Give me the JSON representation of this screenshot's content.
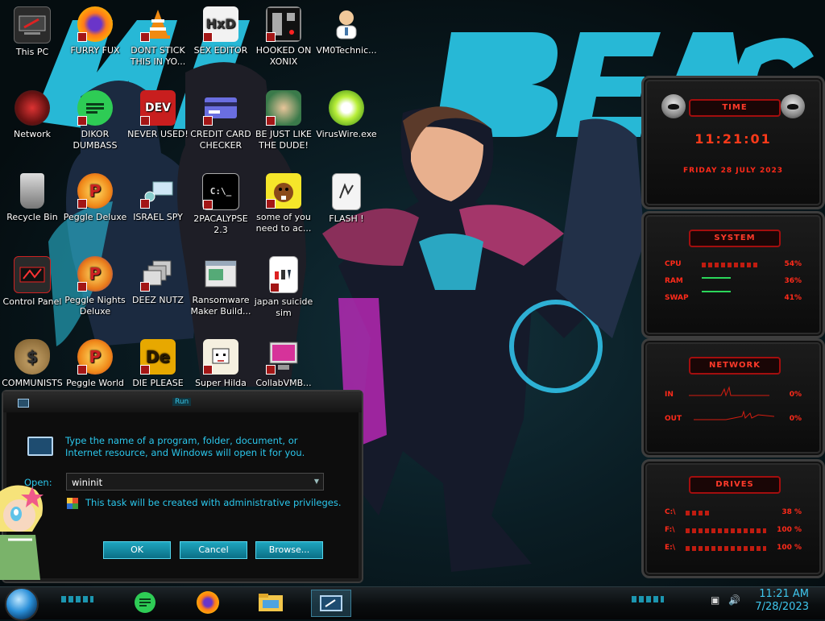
{
  "desktop": {
    "icons": [
      {
        "label": "This PC"
      },
      {
        "label": "FURRY FUX"
      },
      {
        "label": "DONT STICK THIS IN YO..."
      },
      {
        "label": "SEX EDITOR"
      },
      {
        "label": "HOOKED ON XONIX"
      },
      {
        "label": "VM0Technic..."
      },
      {
        "label": "Network"
      },
      {
        "label": "DIKOR DUMBASS"
      },
      {
        "label": "NEVER USED!"
      },
      {
        "label": "CREDIT CARD CHECKER"
      },
      {
        "label": "BE JUST LIKE THE DUDE!"
      },
      {
        "label": "VirusWire.exe"
      },
      {
        "label": "Recycle Bin"
      },
      {
        "label": "Peggle Deluxe"
      },
      {
        "label": "ISRAEL SPY"
      },
      {
        "label": "2PACALYPSE 2.3"
      },
      {
        "label": "some of you need to ac..."
      },
      {
        "label": "FLASH !"
      },
      {
        "label": "Control Panel"
      },
      {
        "label": "Peggle Nights Deluxe"
      },
      {
        "label": "DEEZ NUTZ"
      },
      {
        "label": "Ransomware Maker Build..."
      },
      {
        "label": "japan suicide sim"
      },
      {
        "label": "COMMUNISTS"
      },
      {
        "label": "Peggle World"
      },
      {
        "label": "DIE PLEASE"
      },
      {
        "label": "Super Hilda"
      },
      {
        "label": "CollabVMB..."
      }
    ],
    "icon_glyphs": {
      "dev": "DEV",
      "de": "De",
      "cmd": "C:\\_"
    }
  },
  "widgets": {
    "time": {
      "title": "TIME",
      "time": "11:21:01",
      "date": "FRIDAY 28 JULY 2023"
    },
    "system": {
      "title": "SYSTEM",
      "rows": [
        {
          "label": "CPU",
          "value": "54%"
        },
        {
          "label": "RAM",
          "value": "36%"
        },
        {
          "label": "SWAP",
          "value": "41%"
        }
      ]
    },
    "network": {
      "title": "NETWORK",
      "rows": [
        {
          "label": "IN",
          "value": "0%"
        },
        {
          "label": "OUT",
          "value": "0%"
        }
      ]
    },
    "drives": {
      "title": "DRIVES",
      "rows": [
        {
          "label": "C:\\",
          "value": "38 %"
        },
        {
          "label": "F:\\",
          "value": "100 %"
        },
        {
          "label": "E:\\",
          "value": "100 %"
        }
      ]
    },
    "accent": "#ff2a1a"
  },
  "run_dialog": {
    "title": "Run",
    "message": "Type the name of a program, folder, document, or Internet resource, and Windows will open it for you.",
    "open_label": "Open:",
    "open_value": "wininit",
    "admin_note": "This task will be created with administrative privileges.",
    "ok_label": "OK",
    "cancel_label": "Cancel",
    "browse_label": "Browse...",
    "dropdown_arrow": "▼",
    "accent": "#2bc7ec"
  },
  "taskbar": {
    "clock_time": "11:21 AM",
    "clock_date": "7/28/2023",
    "pinned": [
      "notes-app-icon",
      "firefox-icon",
      "file-explorer-icon",
      "run-dialog-icon"
    ],
    "tray": {
      "network": "▣",
      "volume": "🔊"
    }
  }
}
